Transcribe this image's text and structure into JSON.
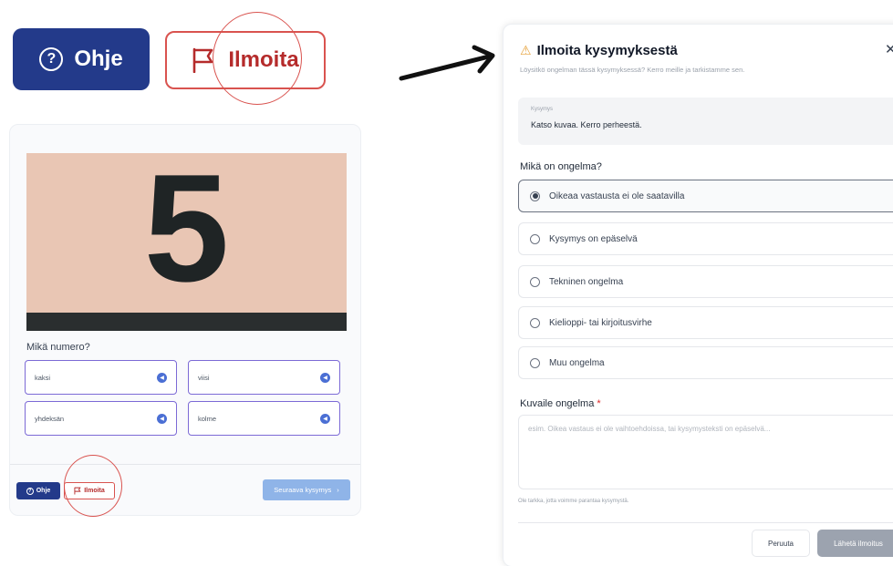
{
  "zoom_buttons": {
    "help_icon": "?",
    "help_label": "Ohje",
    "report_icon": "flag-icon",
    "report_label": "Ilmoita"
  },
  "quiz": {
    "image_digit": "5",
    "question": "Mikä numero?",
    "answers": [
      {
        "label": "kaksi"
      },
      {
        "label": "viisi"
      },
      {
        "label": "yhdeksän"
      },
      {
        "label": "kolme"
      }
    ],
    "help_label": "Ohje",
    "report_label": "Ilmoita",
    "next_label": "Seuraava kysymys",
    "next_chevron": "›"
  },
  "modal": {
    "title": "Ilmoita kysymyksestä",
    "subtitle": "Löysitkö ongelman tässä kysymyksessä? Kerro meille ja tarkistamme sen.",
    "close_glyph": "✕",
    "question_label": "Kysymys",
    "question_text": "Katso kuvaa. Kerro perheestä.",
    "problem_label": "Mikä on ongelma?",
    "options": [
      {
        "label": "Oikeaa vastausta ei ole saatavilla",
        "selected": true
      },
      {
        "label": "Kysymys on epäselvä",
        "selected": false
      },
      {
        "label": "Tekninen ongelma",
        "selected": false
      },
      {
        "label": "Kielioppi- tai kirjoitusvirhe",
        "selected": false
      },
      {
        "label": "Muu ongelma",
        "selected": false
      }
    ],
    "describe_label": "Kuvaile ongelma",
    "required_mark": "*",
    "describe_placeholder": "esim. Oikea vastaus ei ole vaihtoehdoissa, tai kysymysteksti on epäselvä...",
    "helper_text": "Ole tarkka, jotta voimme parantaa kysymystä.",
    "cancel_label": "Peruuta",
    "submit_label": "Lähetä ilmoitus"
  },
  "colors": {
    "primary": "#233a8a",
    "report_red": "#d9534f",
    "answer_border": "#7c6ad6",
    "next_button": "#8fb4e8",
    "submit_disabled": "#9ca3af",
    "warning": "#e6a23c"
  }
}
